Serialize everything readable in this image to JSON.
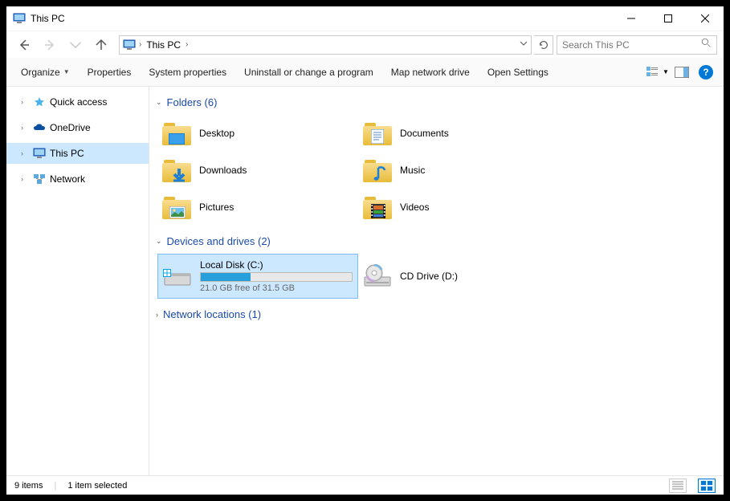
{
  "window": {
    "title": "This PC"
  },
  "addressbar": {
    "crumb": "This PC"
  },
  "search": {
    "placeholder": "Search This PC"
  },
  "toolbar": {
    "organize": "Organize",
    "properties": "Properties",
    "system_properties": "System properties",
    "uninstall": "Uninstall or change a program",
    "map_drive": "Map network drive",
    "open_settings": "Open Settings"
  },
  "sidebar": {
    "items": [
      {
        "label": "Quick access"
      },
      {
        "label": "OneDrive"
      },
      {
        "label": "This PC"
      },
      {
        "label": "Network"
      }
    ]
  },
  "groups": {
    "folders": {
      "header": "Folders (6)",
      "items": [
        {
          "label": "Desktop"
        },
        {
          "label": "Documents"
        },
        {
          "label": "Downloads"
        },
        {
          "label": "Music"
        },
        {
          "label": "Pictures"
        },
        {
          "label": "Videos"
        }
      ]
    },
    "drives": {
      "header": "Devices and drives (2)",
      "items": [
        {
          "label": "Local Disk (C:)",
          "free_text": "21.0 GB free of 31.5 GB",
          "fill_percent": 33
        },
        {
          "label": "CD Drive (D:)"
        }
      ]
    },
    "network": {
      "header": "Network locations (1)"
    }
  },
  "status": {
    "count": "9 items",
    "selection": "1 item selected"
  }
}
